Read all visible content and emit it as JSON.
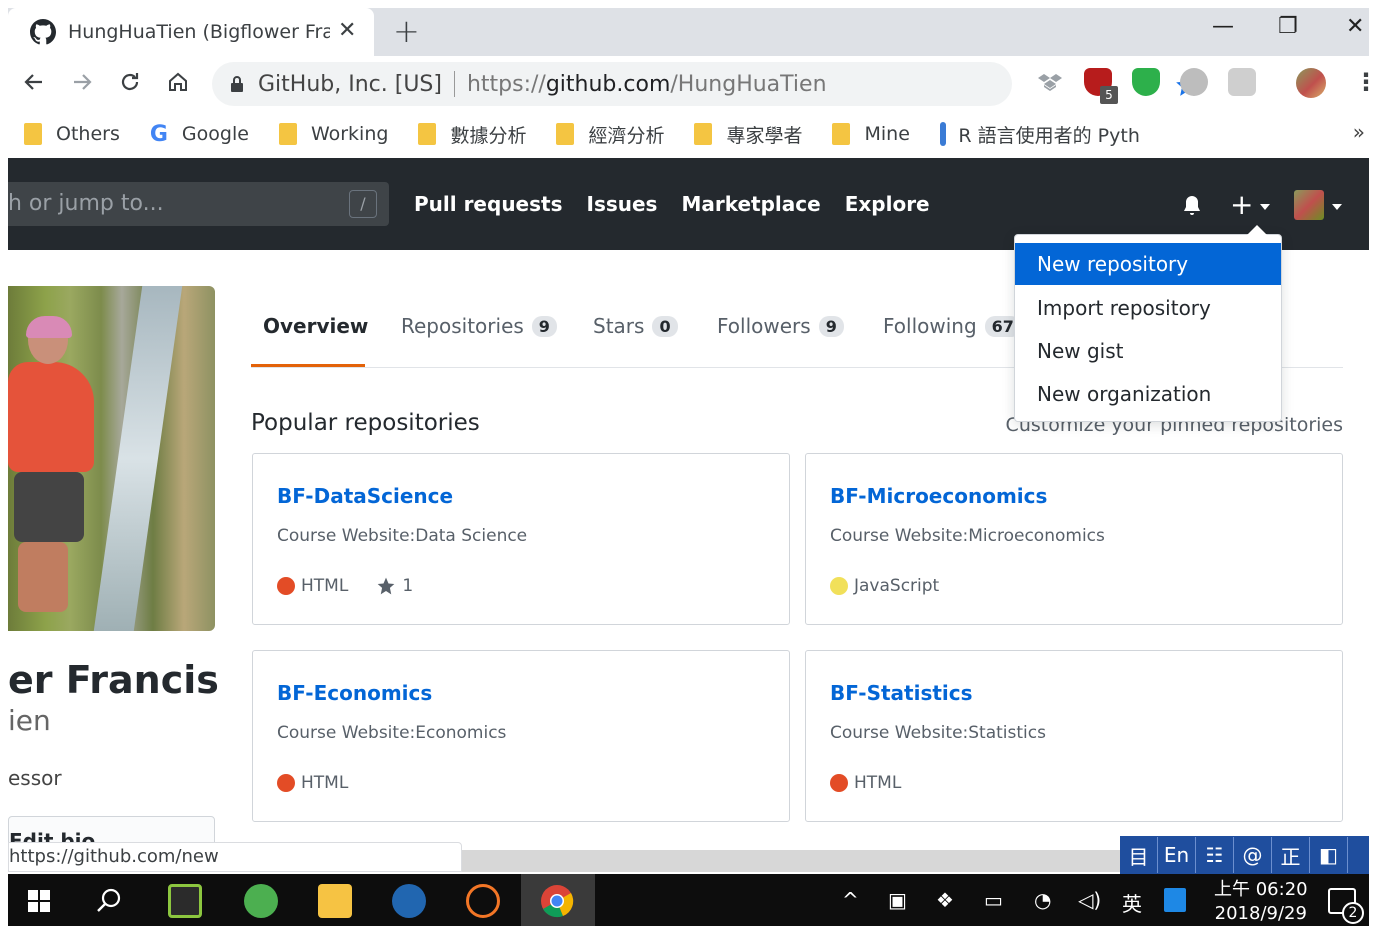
{
  "browser": {
    "tab_title": "HungHuaTien (Bigflower Franci",
    "tab_close": "✕",
    "new_tab": "+",
    "window_minimize": "—",
    "window_restore": "❐",
    "window_close": "✕",
    "omnibox": {
      "org": "GitHub, Inc. [US]",
      "scheme": "https://",
      "host": "github.com",
      "path": "/HungHuaTien"
    },
    "extension_badge": "5",
    "bookmarks": [
      "Others",
      "Google",
      "Working",
      "數據分析",
      "經濟分析",
      "專家學者",
      "Mine",
      "R 語言使用者的 Pyth"
    ],
    "bookmarks_more": "»",
    "status_url": "https://github.com/new"
  },
  "github": {
    "search_placeholder": "h or jump to...",
    "search_shortcut": "/",
    "nav": [
      "Pull requests",
      "Issues",
      "Marketplace",
      "Explore"
    ],
    "plus": "+",
    "dropdown": {
      "items": [
        "New repository",
        "Import repository",
        "New gist",
        "New organization"
      ],
      "selected_index": 0
    }
  },
  "profile": {
    "name": "er Francis",
    "login": "ien",
    "bio": "essor",
    "edit_bio": "Edit bio"
  },
  "tabs": [
    {
      "label": "Overview",
      "count": null,
      "active": true
    },
    {
      "label": "Repositories",
      "count": "9"
    },
    {
      "label": "Stars",
      "count": "0"
    },
    {
      "label": "Followers",
      "count": "9"
    },
    {
      "label": "Following",
      "count": "67"
    }
  ],
  "popular": {
    "heading": "Popular repositories",
    "customize": "Customize your pinned repositories",
    "repos": [
      {
        "name": "BF-DataScience",
        "desc": "Course Website:Data Science",
        "lang": "HTML",
        "lang_color": "#e34c26",
        "stars": "1"
      },
      {
        "name": "BF-Microeconomics",
        "desc": "Course Website:Microeconomics",
        "lang": "JavaScript",
        "lang_color": "#f1e05a",
        "stars": null
      },
      {
        "name": "BF-Economics",
        "desc": "Course Website:Economics",
        "lang": "HTML",
        "lang_color": "#e34c26",
        "stars": null
      },
      {
        "name": "BF-Statistics",
        "desc": "Course Website:Statistics",
        "lang": "HTML",
        "lang_color": "#e34c26",
        "stars": null
      }
    ]
  },
  "ime": [
    "目",
    "En",
    "☷",
    "@",
    "正",
    "◧"
  ],
  "taskbar": {
    "tray_ime": "英",
    "time": "上午 06:20",
    "date": "2018/9/29",
    "notification_count": "2"
  },
  "colors": {
    "accent": "#0366d6",
    "header_bg": "#24292e",
    "tab_underline": "#e36209"
  }
}
